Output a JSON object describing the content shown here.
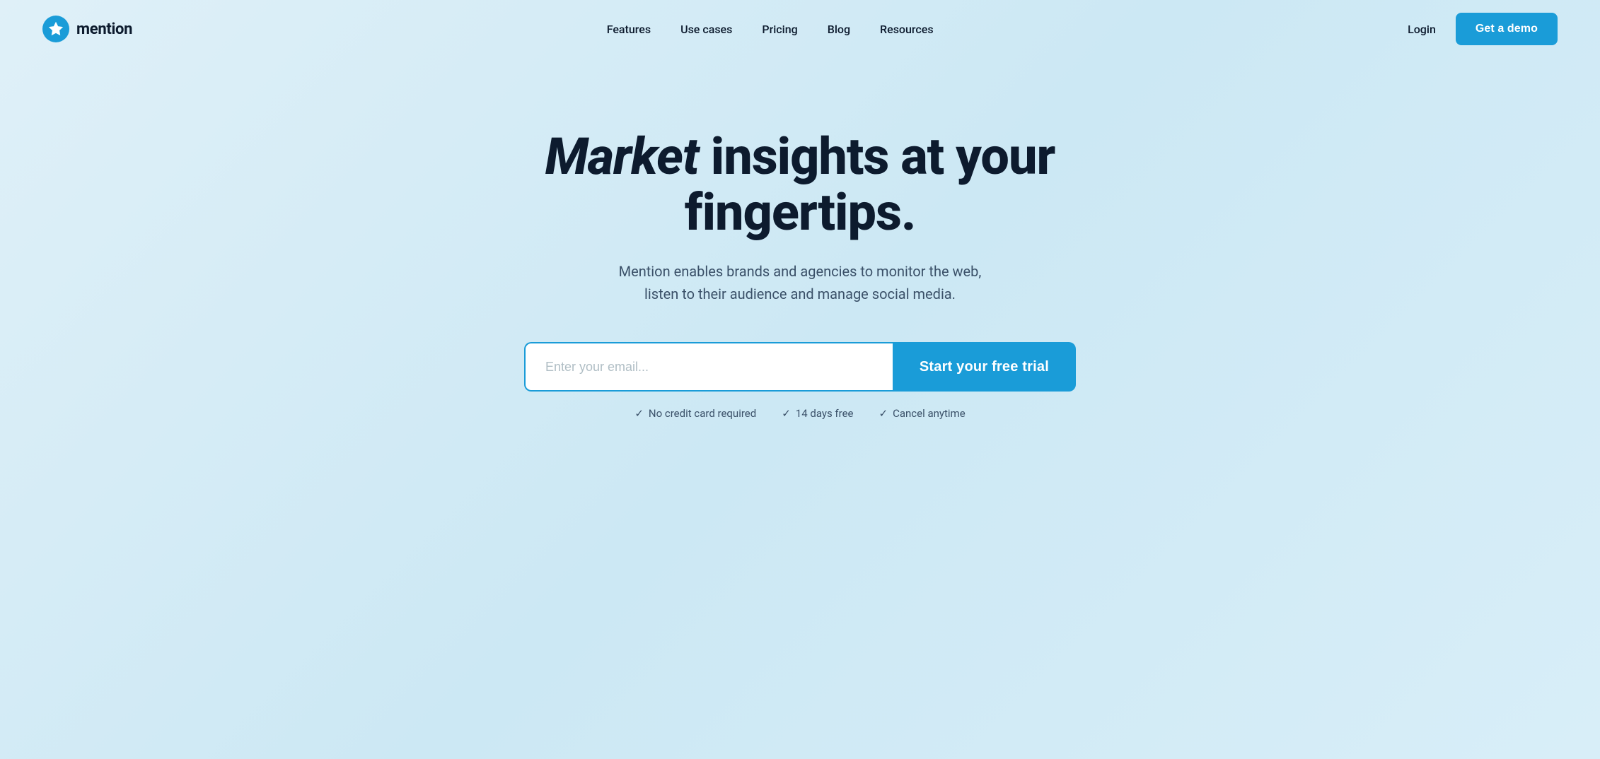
{
  "brand": {
    "name": "mention",
    "logo_alt": "Mention logo"
  },
  "nav": {
    "links": [
      {
        "label": "Features",
        "id": "features"
      },
      {
        "label": "Use cases",
        "id": "use-cases"
      },
      {
        "label": "Pricing",
        "id": "pricing"
      },
      {
        "label": "Blog",
        "id": "blog"
      },
      {
        "label": "Resources",
        "id": "resources"
      }
    ],
    "login_label": "Login",
    "demo_label": "Get a demo"
  },
  "hero": {
    "title_italic": "Market",
    "title_rest": " insights at your fingertips.",
    "subtitle": "Mention enables brands and agencies to monitor the web, listen to their audience and manage social media.",
    "email_placeholder": "Enter your email...",
    "cta_label": "Start your free trial"
  },
  "trust": {
    "items": [
      {
        "text": "No credit card required"
      },
      {
        "text": "14 days free"
      },
      {
        "text": "Cancel anytime"
      }
    ]
  },
  "colors": {
    "accent": "#1a9cd8",
    "dark": "#0d1b2e",
    "muted": "#3a5068"
  }
}
